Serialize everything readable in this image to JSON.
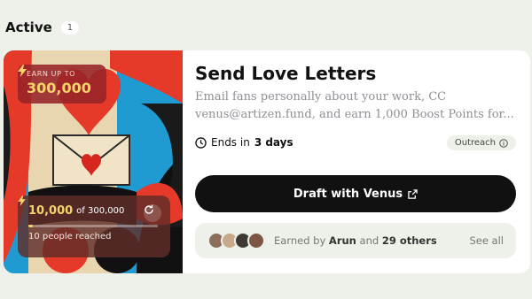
{
  "section": {
    "title": "Active",
    "count": "1"
  },
  "card": {
    "earn_label": "EARN UP TO",
    "earn_amount": "300,000",
    "progress": {
      "value": "10,000",
      "total_text": "of 300,000",
      "fraction": 0.033,
      "reached": "10 people reached"
    },
    "title": "Send Love Letters",
    "description": "Email fans personally about your work, CC venus@artizen.fund, and earn 1,000 Boost Points for...",
    "ends_prefix": "Ends in",
    "ends_value": "3 days",
    "tag": "Outreach",
    "cta": "Draft with Venus",
    "earned": {
      "prefix": "Earned by",
      "name": "Arun",
      "joiner": "and",
      "others": "29 others",
      "see_all": "See all"
    }
  },
  "colors": {
    "accent_gold": "#f5d36b",
    "cta_bg": "#111111",
    "page_bg": "#eef0ea"
  },
  "icons": [
    "lightning-icon",
    "refresh-icon",
    "clock-icon",
    "info-icon",
    "external-link-icon"
  ]
}
